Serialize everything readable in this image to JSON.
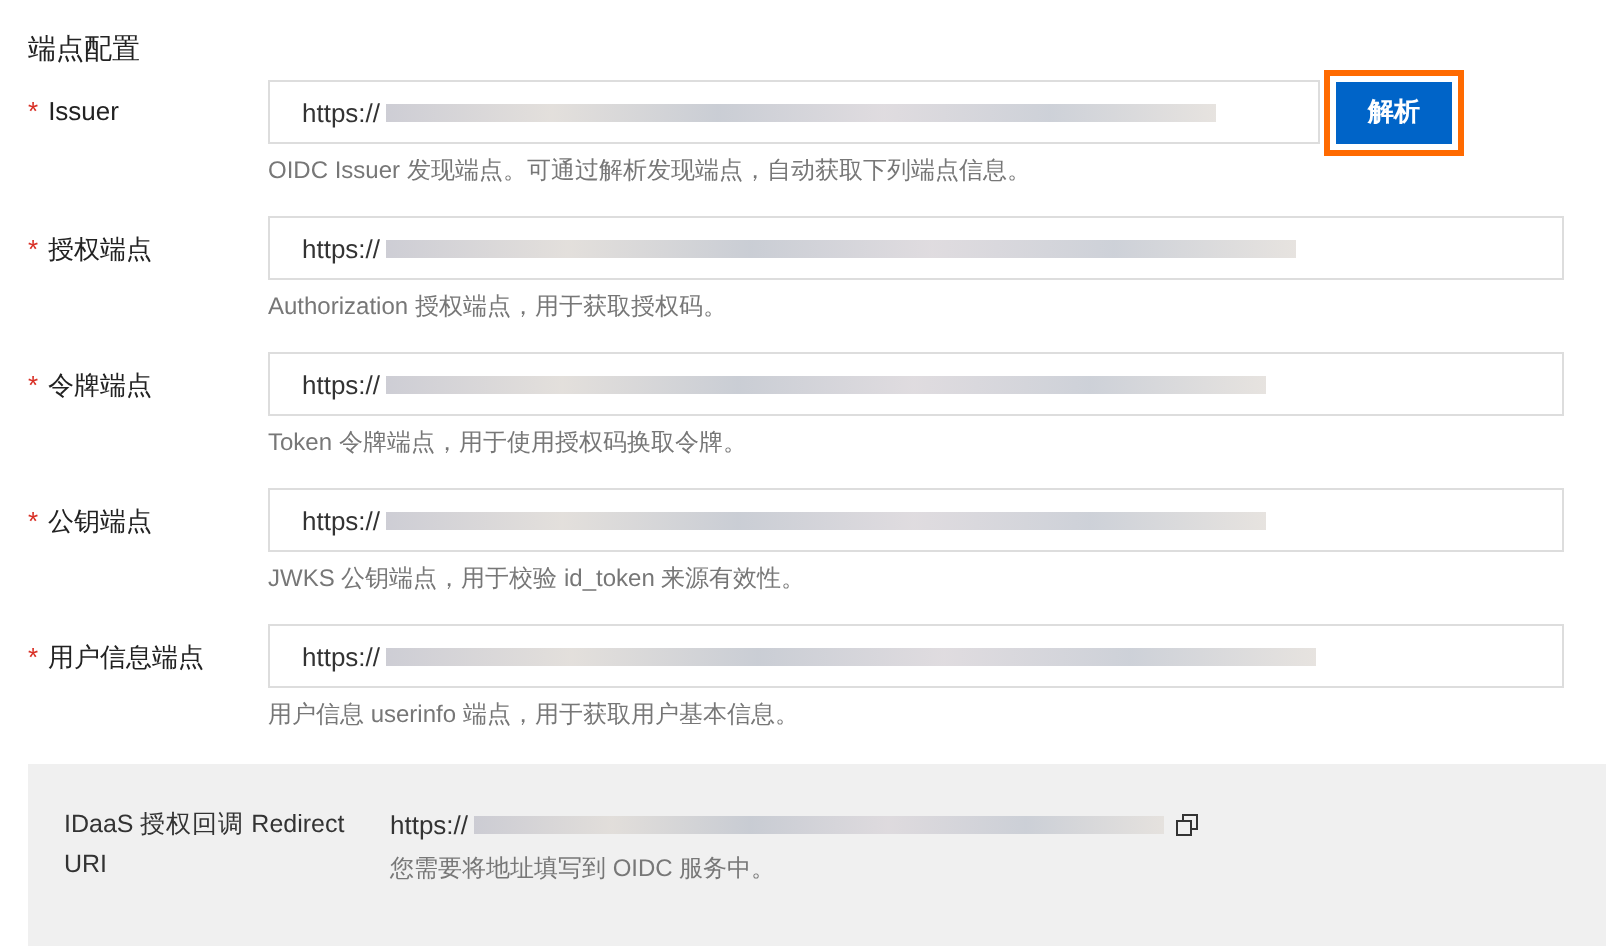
{
  "section_title": "端点配置",
  "fields": [
    {
      "label": "Issuer",
      "required_mark": "*",
      "value": "https://",
      "hint": "OIDC Issuer 发现端点。可通过解析发现端点，自动获取下列端点信息。",
      "button": {
        "label": "解析",
        "highlighted": true
      }
    },
    {
      "label": "授权端点",
      "required_mark": "*",
      "value": "https://",
      "hint": "Authorization 授权端点，用于获取授权码。"
    },
    {
      "label": "令牌端点",
      "required_mark": "*",
      "value": "https://",
      "hint": "Token 令牌端点，用于使用授权码换取令牌。"
    },
    {
      "label": "公钥端点",
      "required_mark": "*",
      "value": "https://",
      "hint": "JWKS 公钥端点，用于校验 id_token 来源有效性。"
    },
    {
      "label": "用户信息端点",
      "required_mark": "*",
      "value": "https://",
      "hint": "用户信息 userinfo 端点，用于获取用户基本信息。"
    }
  ],
  "redirect": {
    "label": "IDaaS 授权回调 Redirect URI",
    "value": "https://",
    "note": "您需要将地址填写到 OIDC 服务中。"
  }
}
